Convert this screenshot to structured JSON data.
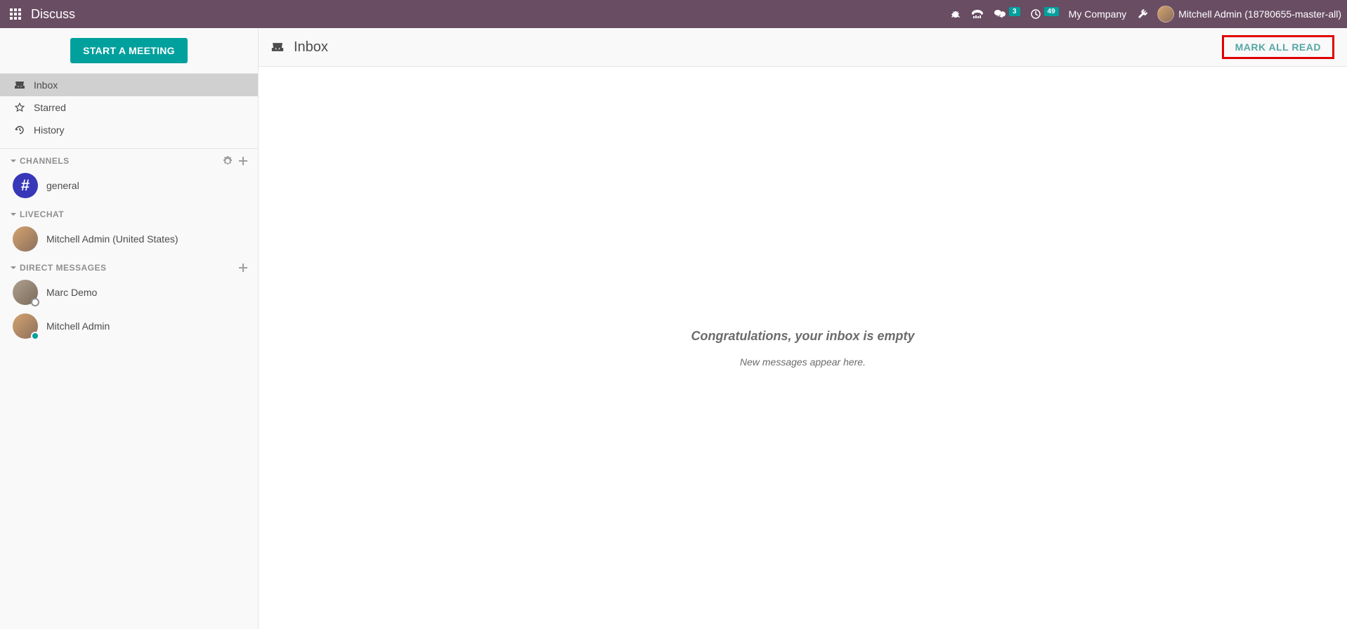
{
  "header": {
    "app_title": "Discuss",
    "messages_badge": "3",
    "activity_badge": "49",
    "company": "My Company",
    "username": "Mitchell Admin (18780655-master-all)"
  },
  "sidebar": {
    "start_meeting": "START A MEETING",
    "mailboxes": [
      {
        "label": "Inbox",
        "icon": "inbox",
        "active": true
      },
      {
        "label": "Starred",
        "icon": "star",
        "active": false
      },
      {
        "label": "History",
        "icon": "history",
        "active": false
      }
    ],
    "channels_header": "CHANNELS",
    "channels": [
      {
        "label": "general"
      }
    ],
    "livechat_header": "LIVECHAT",
    "livechat": [
      {
        "label": "Mitchell Admin (United States)"
      }
    ],
    "dm_header": "DIRECT MESSAGES",
    "dms": [
      {
        "label": "Marc Demo",
        "presence": "offline"
      },
      {
        "label": "Mitchell Admin",
        "presence": "online"
      }
    ]
  },
  "content": {
    "title": "Inbox",
    "mark_all_read": "MARK ALL READ",
    "empty_title": "Congratulations, your inbox is empty",
    "empty_sub": "New messages appear here."
  }
}
